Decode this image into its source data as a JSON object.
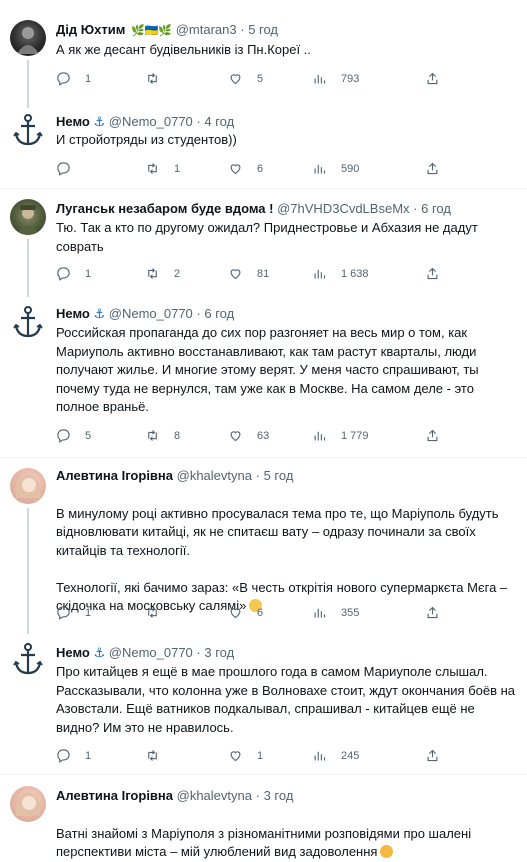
{
  "tweets": [
    {
      "author": "Дід Юхтим",
      "name_emoji": "🌿🇺🇦🌿",
      "handle": "@mtaran3",
      "time": "5 год",
      "text": "А як же десант будівельників із Пн.Кореї ..",
      "replies": "1",
      "retweets": "",
      "likes": "5",
      "views": "793"
    },
    {
      "author": "Немо",
      "name_emoji": "⚓",
      "handle": "@Nemo_0770",
      "time": "4 год",
      "text": "И стройотряды из студентов))",
      "replies": "",
      "retweets": "1",
      "likes": "6",
      "views": "590"
    },
    {
      "author": "Луганськ незабаром буде вдома !",
      "name_emoji": "",
      "handle": "@7hVHD3CvdLBseMx",
      "time": "6 год",
      "text": "Тю. Так а кто по другому ожидал? Приднестровье и Абхазия не дадут соврать",
      "replies": "1",
      "retweets": "2",
      "likes": "81",
      "views": "1 638"
    },
    {
      "author": "Немо",
      "name_emoji": "⚓",
      "handle": "@Nemo_0770",
      "time": "6 год",
      "text": "Российская пропаганда до сих пор разгоняет на весь мир о том, как Мариуполь активно восстанавливают, как там растут кварталы, люди получают жилье. И многие этому верят. У меня часто спрашивают, ты почему туда не вернулся, там уже как в Москве. На самом деле - это полное враньё.",
      "replies": "5",
      "retweets": "8",
      "likes": "63",
      "views": "1 779"
    },
    {
      "author": "Алевтина Ігорівна",
      "name_emoji": "",
      "handle": "@khalevtyna",
      "time": "5 год",
      "text": "В минулому році активно просувалася тема про те, що Маріуполь будуть відновлювати китайці, як не спитаєш вату – одразу починали за своїх китайців та технології.\n\nТехнології, які бачимо зараз: «В честь открітія нового супермаркєта Мєга – скідочка на московську салямі»",
      "replies": "1",
      "retweets": "",
      "likes": "6",
      "views": "355"
    },
    {
      "author": "Немо",
      "name_emoji": "⚓",
      "handle": "@Nemo_0770",
      "time": "3 год",
      "text": "Про китайцев я ещё в мае прошлого года в самом Мариуполе слышал. Рассказывали, что колонна уже в Волновахе стоит, ждут окончания боёв на Азовстали. Ещё ватников подкалывал, спрашивал - китайцев ещё не видно? Им это не нравилось.",
      "replies": "1",
      "retweets": "",
      "likes": "1",
      "views": "245"
    },
    {
      "author": "Алевтина Ігорівна",
      "name_emoji": "",
      "handle": "@khalevtyna",
      "time": "3 год",
      "text": "Ватні знайомі з Маріуполя з різноманітними розповідями про шалені перспективи міста – мій улюблений вид задоволення",
      "replies": "",
      "retweets": "",
      "likes": "",
      "views": ""
    }
  ]
}
